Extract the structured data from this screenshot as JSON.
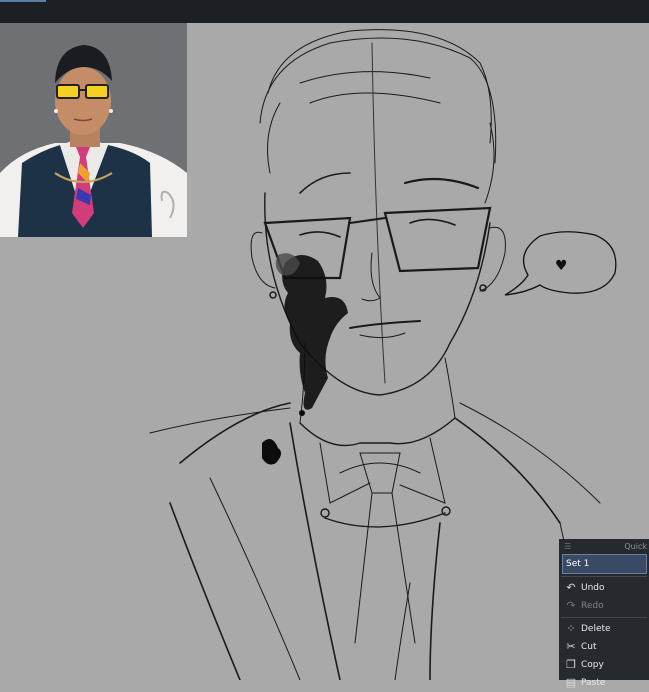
{
  "app": {
    "window_tab_active": true
  },
  "quick_access": {
    "title": "Quick",
    "set_label": "Set 1",
    "items": [
      {
        "label": "Undo",
        "icon": "undo-icon",
        "enabled": true
      },
      {
        "label": "Redo",
        "icon": "redo-icon",
        "enabled": false
      },
      {
        "label": "Delete",
        "icon": "delete-icon",
        "enabled": true
      },
      {
        "label": "Cut",
        "icon": "cut-icon",
        "enabled": true
      },
      {
        "label": "Copy",
        "icon": "copy-icon",
        "enabled": true
      },
      {
        "label": "Paste",
        "icon": "paste-icon",
        "enabled": true
      }
    ]
  },
  "speech_bubble": {
    "symbol": "♥"
  },
  "colors": {
    "canvas": "#a9a9a9",
    "topbar": "#1c1f24",
    "panel": "#26292e",
    "panel_selected": "#3a4a66",
    "ink": "#111111"
  }
}
